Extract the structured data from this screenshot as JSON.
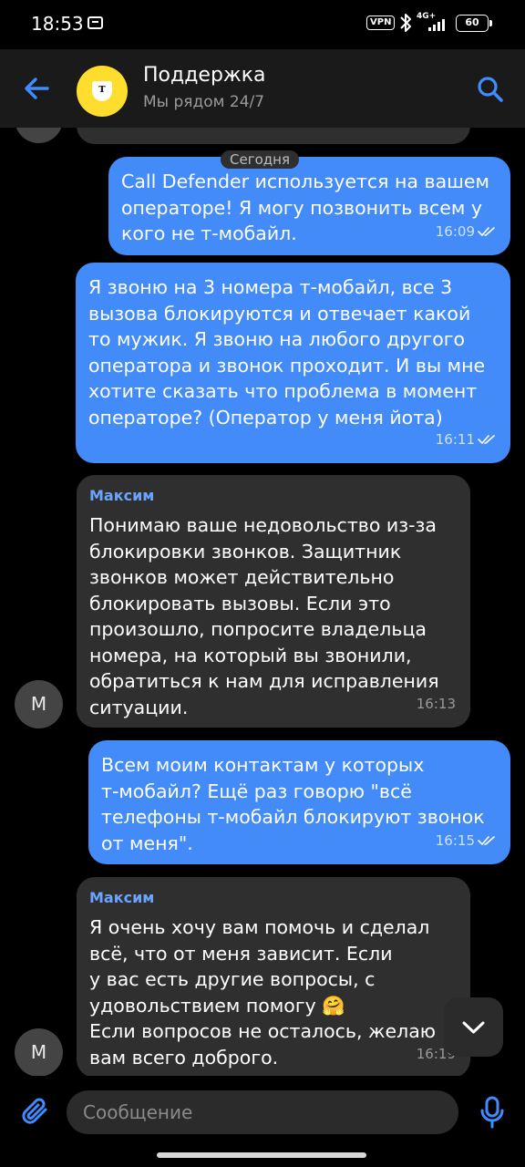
{
  "status_bar": {
    "time": "18:53",
    "vpn": "VPN",
    "network": "4G+",
    "battery": "60"
  },
  "header": {
    "title": "Поддержка",
    "subtitle": "Мы рядом 24/7",
    "logo_letter": "т"
  },
  "chat": {
    "date_divider": "Сегодня",
    "messages": [
      {
        "direction": "outgoing",
        "text": "Call Defender используется на вашем\nоператоре! Я могу позвонить всем у\nкого не т-мобайл.",
        "time": "16:09",
        "read": true
      },
      {
        "direction": "outgoing",
        "text": "Я звоню на 3 номера т-мобайл, все 3\nвызова блокируются и отвечает какой\nто мужик. Я звоню на любого другого\nоператора и звонок проходит. И вы мне\nхотите сказать что проблема в момент\nоператоре? (Оператор у меня йота)",
        "time": "16:11",
        "read": true
      },
      {
        "direction": "incoming",
        "sender": "Максим",
        "avatar_letter": "М",
        "text": "Понимаю ваше недовольство из-за\nблокировки звонков. Защитник\nзвонков может действительно\nблокировать вызовы. Если это\nпроизошло, попросите владельца\nномера, на который вы звонили,\nобратиться к нам для исправления\nситуации.",
        "time": "16:13"
      },
      {
        "direction": "outgoing",
        "text": "Всем моим контактам у которых\nт-мобайл? Ещё раз говорю \"всё\nтелефоны т-мобайл блокируют звонок\nот меня\".",
        "time": "16:15",
        "read": true
      },
      {
        "direction": "incoming",
        "sender": "Максим",
        "avatar_letter": "М",
        "text": "Я очень хочу вам помочь и сделал\nвсё, что от меня зависит. Если\nу вас есть другие вопросы, с\nудовольствием помогу 🤗\nЕсли вопросов не осталось, желаю\nвам всего доброго.",
        "time": "16:19"
      }
    ]
  },
  "input": {
    "placeholder": "Сообщение"
  },
  "colors": {
    "outgoing_bubble": "#428bf9",
    "incoming_bubble": "#2f2f2f",
    "accent": "#3f8cff",
    "logo_yellow": "#ffdd2d"
  }
}
